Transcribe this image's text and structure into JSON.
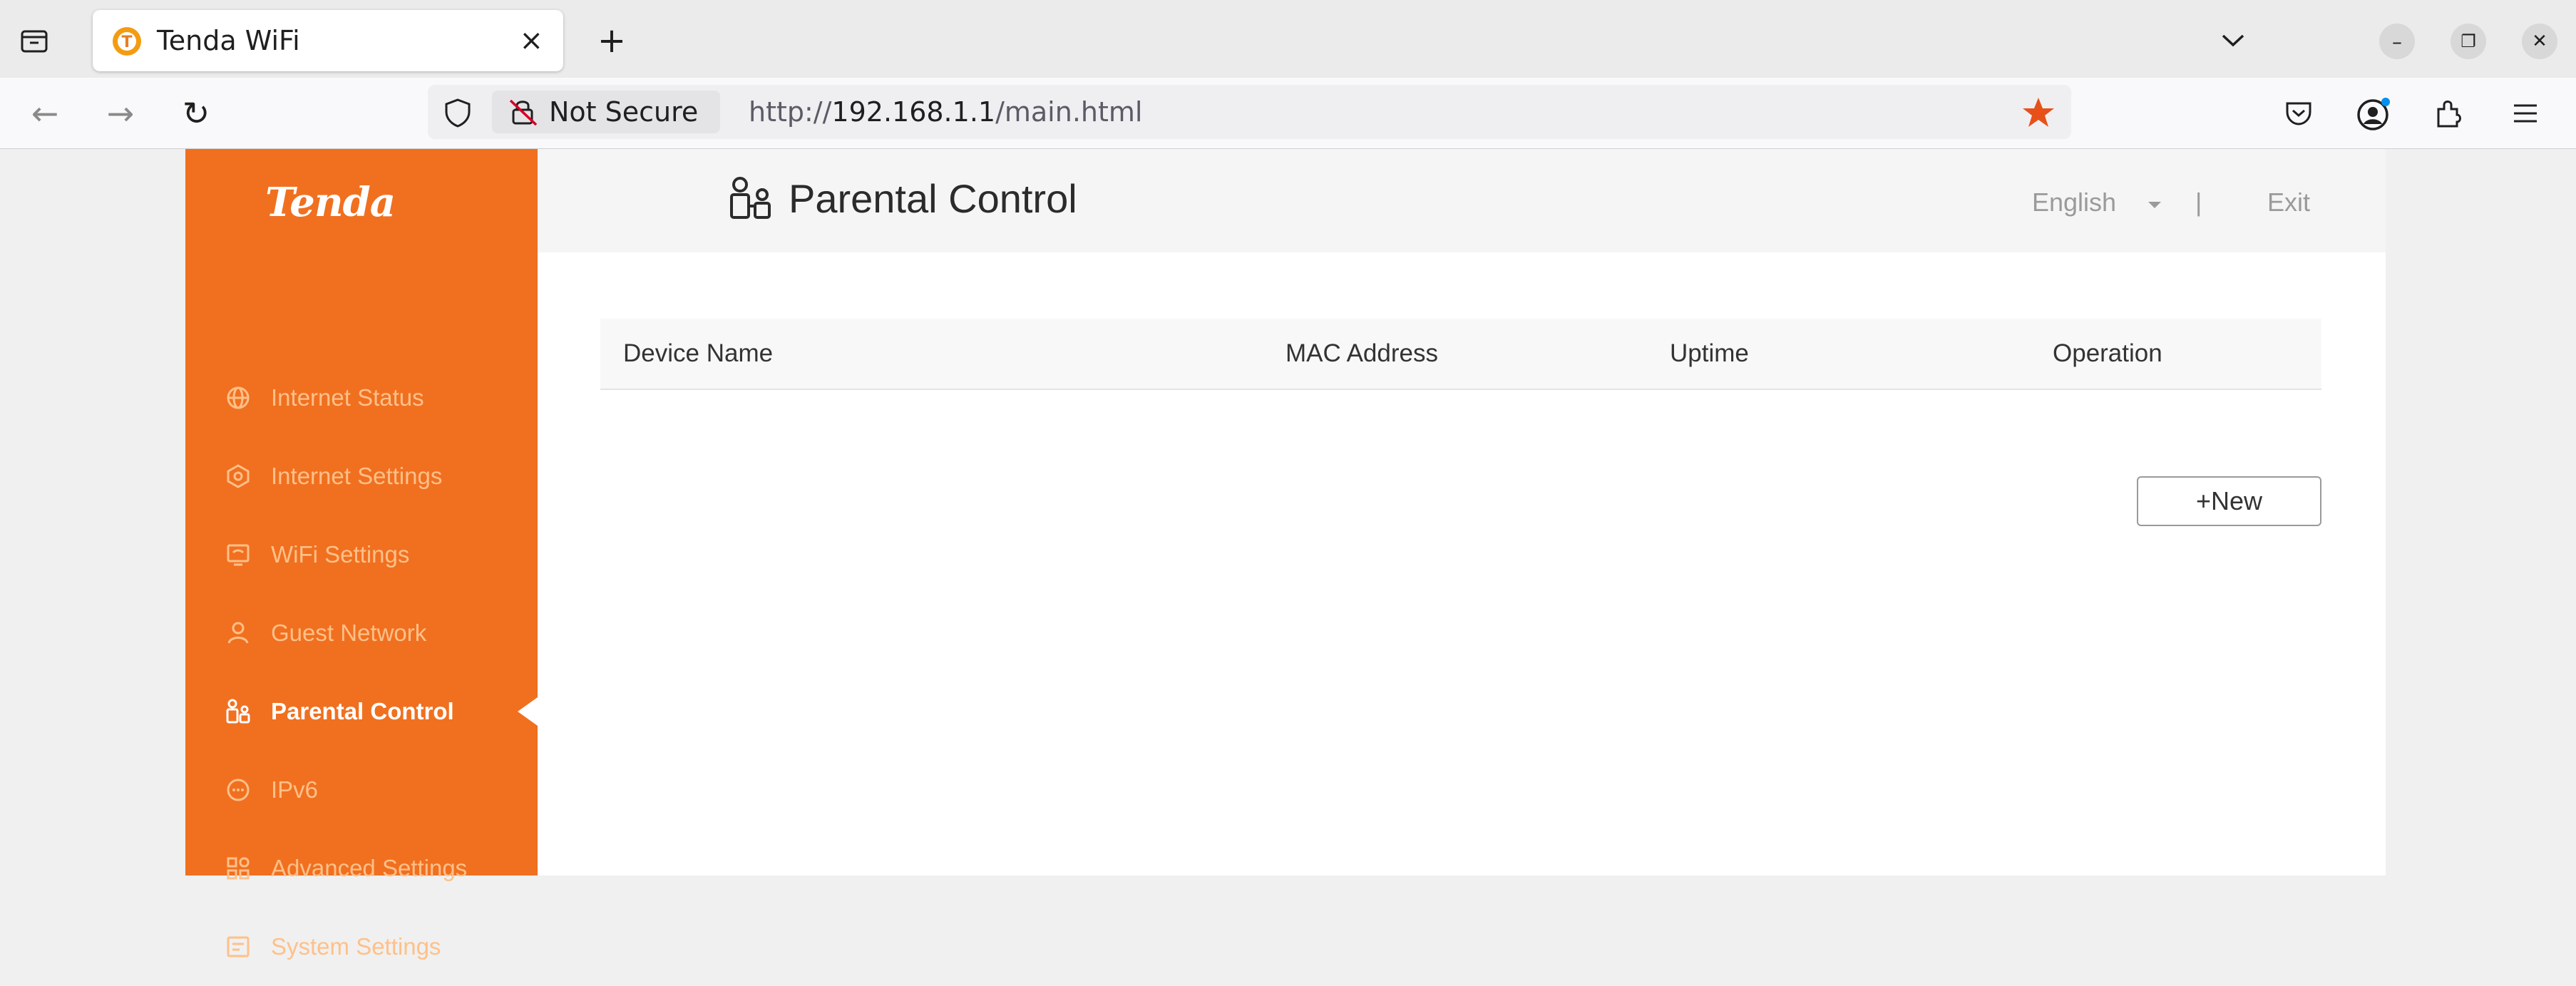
{
  "browser": {
    "tab": {
      "title": "Tenda WiFi",
      "close_glyph": "×"
    },
    "new_tab_glyph": "+",
    "list_all_tabs_glyph": "⌄",
    "window": {
      "minimize": "–",
      "restore": "❐",
      "close": "✕"
    },
    "nav": {
      "back": "←",
      "forward": "→",
      "reload": "↻"
    },
    "security_label": "Not Secure",
    "url": {
      "scheme": "http://",
      "host": "192.168.1.1",
      "path": "/main.html"
    },
    "bookmark_star_color": "#e8501a",
    "toolbar_icons": [
      "pocket-icon",
      "account-icon",
      "extensions-icon",
      "menu-icon"
    ]
  },
  "sidebar": {
    "logo": "Tenda",
    "background": "#f07020",
    "items": [
      {
        "label": "Internet Status",
        "icon": "globe-icon",
        "active": false
      },
      {
        "label": "Internet Settings",
        "icon": "network-icon",
        "active": false
      },
      {
        "label": "WiFi Settings",
        "icon": "wifi-screen-icon",
        "active": false
      },
      {
        "label": "Guest Network",
        "icon": "guest-icon",
        "active": false
      },
      {
        "label": "Parental Control",
        "icon": "parental-icon",
        "active": true
      },
      {
        "label": "IPv6",
        "icon": "ipv6-icon",
        "active": false
      },
      {
        "label": "Advanced Settings",
        "icon": "grid-icon",
        "active": false
      },
      {
        "label": "System Settings",
        "icon": "system-icon",
        "active": false
      }
    ]
  },
  "header": {
    "title": "Parental Control",
    "language": "English",
    "separator": "|",
    "exit": "Exit"
  },
  "table": {
    "columns": [
      "Device Name",
      "MAC Address",
      "Uptime",
      "Operation"
    ],
    "rows": []
  },
  "actions": {
    "new_label": "+New"
  }
}
